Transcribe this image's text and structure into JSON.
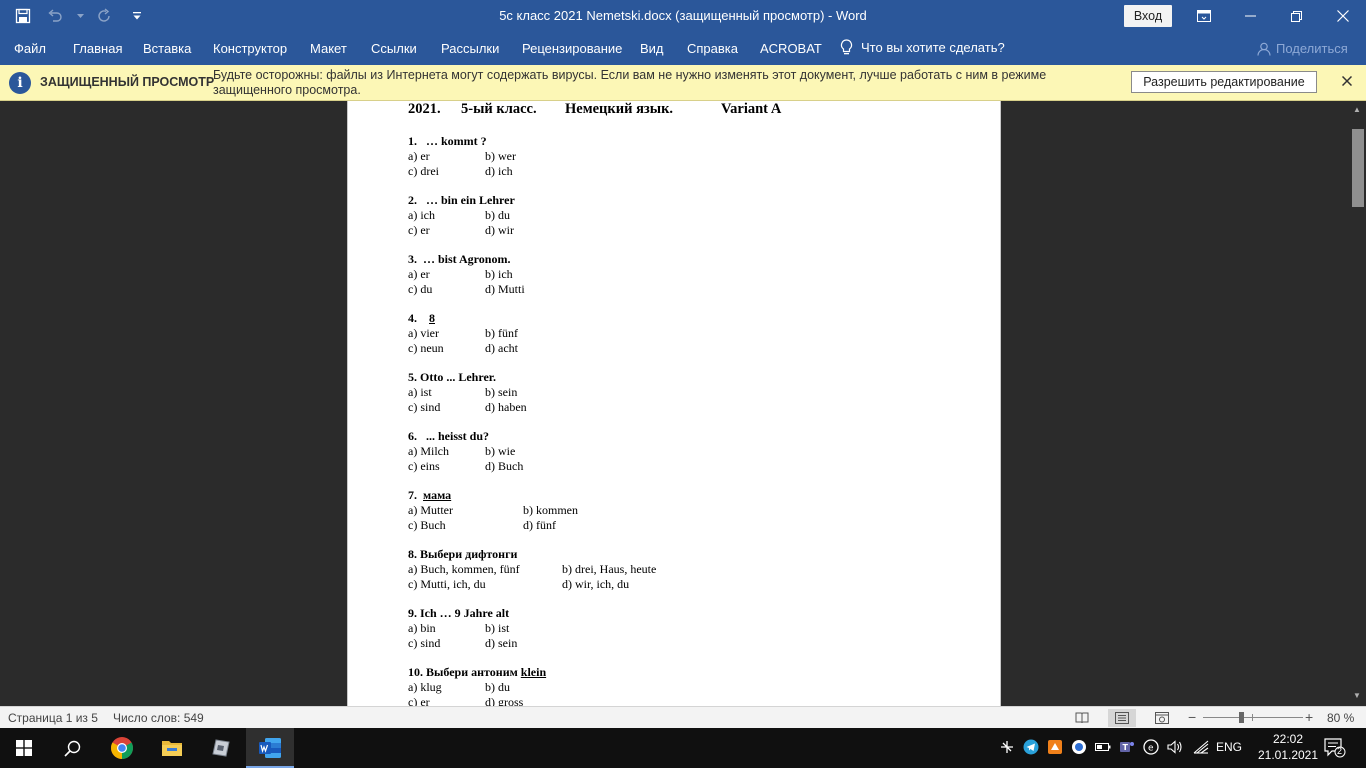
{
  "window": {
    "title": "5с класс 2021  Nemetski.docx (защищенный просмотр)  -  Word",
    "sign_in": "Вход"
  },
  "menu": {
    "items": [
      "Файл",
      "Главная",
      "Вставка",
      "Конструктор",
      "Макет",
      "Ссылки",
      "Рассылки",
      "Рецензирование",
      "Вид",
      "Справка",
      "ACROBAT"
    ],
    "tell_me": "Что вы хотите сделать?",
    "share": "Поделиться"
  },
  "protected_view": {
    "title": "ЗАЩИЩЕННЫЙ ПРОСМОТР",
    "message": "Будьте осторожны: файлы из Интернета могут содержать вирусы. Если вам не нужно изменять этот документ, лучше работать с ним в режиме защищенного просмотра.",
    "enable_button": "Разрешить редактирование"
  },
  "document": {
    "heading": {
      "year": "2021.",
      "grade": "5-ый класс.",
      "subject": "Немецкий язык.",
      "variant": "Variant A"
    },
    "questions": [
      {
        "title": "1.   … kommt ?",
        "underline": "",
        "options": [
          "a) er",
          "b) wer",
          "c) drei",
          "d) ich"
        ]
      },
      {
        "title": "2.   … bin ein Lehrer",
        "underline": "",
        "options": [
          "a) ich",
          "b) du",
          "c) er",
          "d) wir"
        ]
      },
      {
        "title": "3.  … bist Agronom.",
        "underline": "",
        "options": [
          "a) er",
          "b) ich",
          "c) du",
          "d) Mutti"
        ]
      },
      {
        "title": "4.    ",
        "underline": "8",
        "options": [
          "a) vier",
          "b) fünf",
          "c) neun",
          "d) acht"
        ]
      },
      {
        "title": "5. Otto ... Lehrer.",
        "underline": "",
        "options": [
          "a) ist",
          "b) sein",
          "c) sind",
          "d) haben"
        ]
      },
      {
        "title": "6.   ... heisst du?",
        "underline": "",
        "options": [
          "a) Milch",
          "b) wie",
          "c) eins",
          "d) Buch"
        ]
      },
      {
        "title": "7.  ",
        "underline": "мама",
        "options": [
          "a) Mutter",
          "b) kommen",
          "c) Buch",
          "d) fünf"
        ]
      },
      {
        "title": "8. Выбери дифтонги",
        "underline": "",
        "options": [
          "a) Buch, kommen, fünf",
          "b) drei, Haus, heute",
          "c) Mutti, ich, du",
          "d) wir, ich, du"
        ]
      },
      {
        "title": "9. Ich … 9 Jahre alt",
        "underline": "",
        "options": [
          "a) bin",
          "b) ist",
          "c) sind",
          "d) sein"
        ]
      },
      {
        "title": "10. Выбери антоним ",
        "underline": "klein",
        "options": [
          "a) klug",
          "b) du",
          "c) er",
          "d) gross"
        ]
      }
    ]
  },
  "status": {
    "page": "Страница 1 из 5",
    "words": "Число слов: 549",
    "zoom": "80 %",
    "zoom_level_percent": 80
  },
  "taskbar": {
    "language": "ENG",
    "time": "22:02",
    "date": "21.01.2021",
    "notifications": "2"
  },
  "colors": {
    "word_blue": "#2b579a",
    "protected_bar": "#fcf7b6",
    "taskbar": "#101010"
  }
}
